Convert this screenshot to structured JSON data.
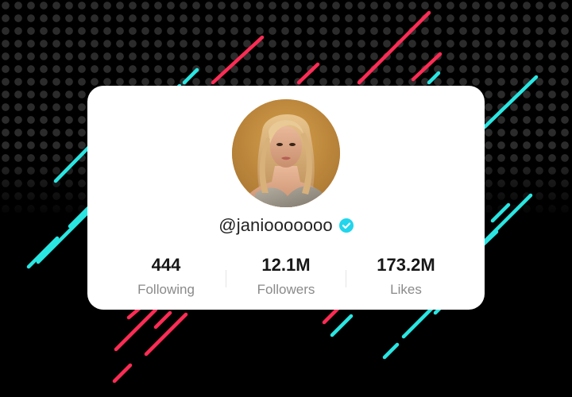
{
  "profile": {
    "username": "@janiooooooo",
    "verified": true,
    "avatar_alt": "profile photo"
  },
  "stats": [
    {
      "value": "444",
      "label": "Following"
    },
    {
      "value": "12.1M",
      "label": "Followers"
    },
    {
      "value": "173.2M",
      "label": "Likes"
    }
  ],
  "colors": {
    "background": "#000000",
    "card": "#ffffff",
    "accent_cyan": "#2ae6e2",
    "accent_red": "#fe2c55",
    "verified_badge": "#20d5ec",
    "stat_value": "#171717",
    "stat_label": "#8a8a8a"
  },
  "icons": {
    "verified": "verified-check-icon"
  }
}
